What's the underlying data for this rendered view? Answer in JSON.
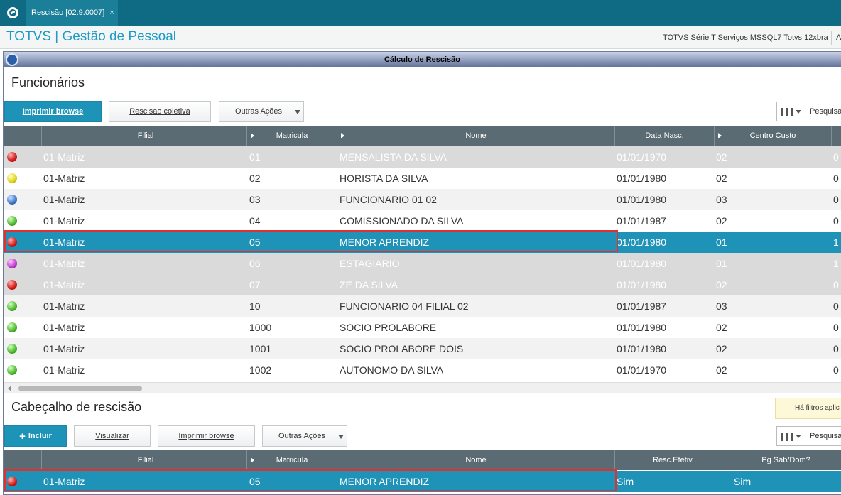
{
  "tab": {
    "title": "Rescisão [02.9.0007]",
    "close": "×"
  },
  "header": {
    "app_title": "TOTVS | Gestão de Pessoal",
    "system_info": "TOTVS Série T Serviços MSSQL7 Totvs 12xbra",
    "cut": "A"
  },
  "window": {
    "title": "Cálculo de Rescisão"
  },
  "funcionarios": {
    "section_title": "Funcionários",
    "buttons": {
      "print": "Imprimir browse",
      "collective": "Rescisao coletiva",
      "more": "Outras Ações"
    },
    "search_label": "Pesquisa",
    "columns": [
      "Filial",
      "Matricula",
      "Nome",
      "Data Nasc.",
      "Centro Custo"
    ],
    "rows": [
      {
        "status": "red",
        "filial": "01-Matriz",
        "matricula": "01",
        "nome": "MENSALISTA DA SILVA",
        "nasc": "01/01/1970",
        "cc": "02",
        "extra": "0",
        "style": "dim"
      },
      {
        "status": "yellow",
        "filial": "01-Matriz",
        "matricula": "02",
        "nome": "HORISTA DA SILVA",
        "nasc": "01/01/1980",
        "cc": "02",
        "extra": "0",
        "style": "normal"
      },
      {
        "status": "blue",
        "filial": "01-Matriz",
        "matricula": "03",
        "nome": "FUNCIONARIO 01 02",
        "nasc": "01/01/1980",
        "cc": "03",
        "extra": "0",
        "style": "alt"
      },
      {
        "status": "green",
        "filial": "01-Matriz",
        "matricula": "04",
        "nome": "COMISSIONADO DA SILVA",
        "nasc": "01/01/1987",
        "cc": "02",
        "extra": "0",
        "style": "normal"
      },
      {
        "status": "red",
        "filial": "01-Matriz",
        "matricula": "05",
        "nome": "MENOR APRENDIZ",
        "nasc": "01/01/1980",
        "cc": "01",
        "extra": "1",
        "style": "sel"
      },
      {
        "status": "magenta",
        "filial": "01-Matriz",
        "matricula": "06",
        "nome": "ESTAGIARIO",
        "nasc": "01/01/1980",
        "cc": "01",
        "extra": "1",
        "style": "dim"
      },
      {
        "status": "red",
        "filial": "01-Matriz",
        "matricula": "07",
        "nome": "ZE DA SILVA",
        "nasc": "01/01/1980",
        "cc": "02",
        "extra": "0",
        "style": "dim"
      },
      {
        "status": "green",
        "filial": "01-Matriz",
        "matricula": "10",
        "nome": "FUNCIONARIO 04 FILIAL 02",
        "nasc": "01/01/1987",
        "cc": "03",
        "extra": "0",
        "style": "alt"
      },
      {
        "status": "green",
        "filial": "01-Matriz",
        "matricula": "1000",
        "nome": "SOCIO PROLABORE",
        "nasc": "01/01/1980",
        "cc": "02",
        "extra": "0",
        "style": "normal"
      },
      {
        "status": "green",
        "filial": "01-Matriz",
        "matricula": "1001",
        "nome": "SOCIO PROLABORE DOIS",
        "nasc": "01/01/1980",
        "cc": "02",
        "extra": "0",
        "style": "alt"
      },
      {
        "status": "green",
        "filial": "01-Matriz",
        "matricula": "1002",
        "nome": "AUTONOMO DA SILVA",
        "nasc": "01/01/1970",
        "cc": "02",
        "extra": "0",
        "style": "normal"
      }
    ]
  },
  "rescisao": {
    "section_title": "Cabeçalho de rescisão",
    "filter_notice": "Há filtros aplic",
    "buttons": {
      "add_icon": "+",
      "add": "Incluir",
      "view": "Visualizar",
      "print": "Imprimir browse",
      "more": "Outras Ações"
    },
    "search_label": "Pesquisa",
    "columns": [
      "Filial",
      "Matricula",
      "Nome",
      "Resc.Efetiv.",
      "Pg Sab/Dom?"
    ],
    "rows": [
      {
        "status": "red",
        "filial": "01-Matriz",
        "matricula": "05",
        "nome": "MENOR APRENDIZ",
        "efetiv": "Sim",
        "pgsab": "Sim"
      }
    ]
  }
}
